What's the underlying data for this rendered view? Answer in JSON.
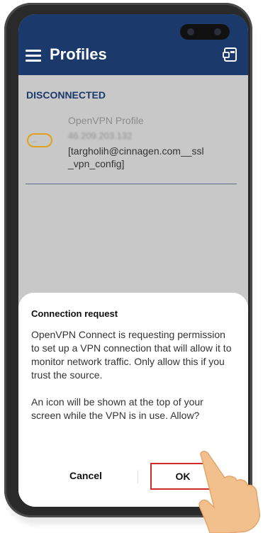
{
  "appbar": {
    "title": "Profiles",
    "menu_icon": "hamburger-menu-icon",
    "import_icon": "import-profile-icon",
    "bar_color": "#1b3a6b"
  },
  "connection": {
    "status": "DISCONNECTED"
  },
  "profile": {
    "type": "OpenVPN Profile",
    "server": "46.209.203.132",
    "name": "[targholih@cinnagen.com__ssl _vpn_config]",
    "toggle_color": "#e0a21a"
  },
  "dialog": {
    "title": "Connection request",
    "message_1": "OpenVPN Connect is requesting permission to set up a VPN connection that will allow it to monitor network traffic. Only allow this if you trust the source.",
    "message_2": "An icon will be shown at the top of your screen while the VPN is in use. Allow?",
    "cancel_label": "Cancel",
    "ok_label": "OK",
    "highlight_color": "#d22a2a"
  }
}
